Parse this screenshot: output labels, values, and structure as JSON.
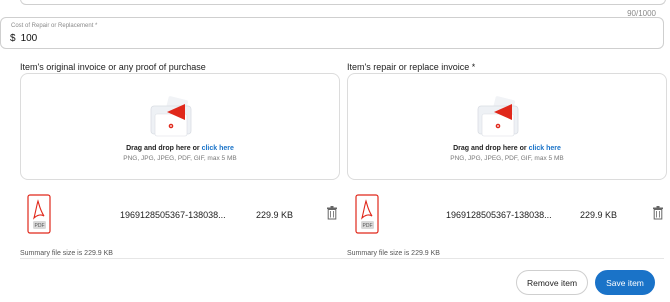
{
  "description_field": {
    "counter": "90/1000"
  },
  "cost_field": {
    "label": "Cost of Repair or Replacement *",
    "currency": "$",
    "value": "100"
  },
  "columns": [
    {
      "title": "Item's original invoice or any proof of purchase",
      "dropzone": {
        "text": "Drag and drop here or ",
        "link": "click here",
        "hint": "PNG, JPG, JPEG, PDF, GIF, max 5 MB"
      },
      "file": {
        "type_label": "PDF",
        "name": "1969128505367-138038...",
        "size": "229.9 KB"
      },
      "summary": "Summary file size is 229.9 KB"
    },
    {
      "title": "Item's repair or replace invoice *",
      "dropzone": {
        "text": "Drag and drop here or ",
        "link": "click here",
        "hint": "PNG, JPG, JPEG, PDF, GIF, max 5 MB"
      },
      "file": {
        "type_label": "PDF",
        "name": "1969128505367-138038...",
        "size": "229.9 KB"
      },
      "summary": "Summary file size is 229.9 KB"
    }
  ],
  "actions": {
    "remove_label": "Remove item",
    "save_label": "Save item"
  },
  "colors": {
    "accent": "#1a73c8",
    "pdf_red": "#e0281b",
    "border": "#cfcfcf"
  }
}
